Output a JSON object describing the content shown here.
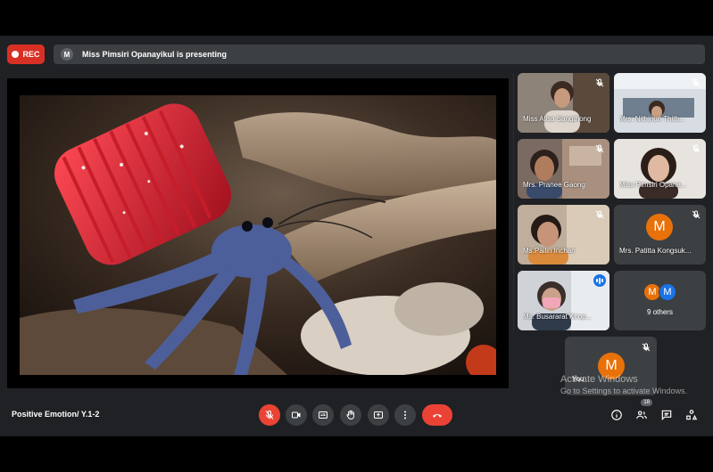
{
  "topbar": {
    "rec_label": "REC",
    "presenter_initial": "M",
    "presenting_text": "Miss Pimsiri Opanayikul is presenting"
  },
  "participants": [
    {
      "name": "Miss Alisa Sangthong"
    },
    {
      "name": "Mrs. Nithinun Thith..."
    },
    {
      "name": "Mrs. Pranee Gaong"
    },
    {
      "name": "Miss Pimsiri Opana..."
    },
    {
      "name": "Ms.Pailin Inchan"
    },
    {
      "name": "Mrs. Patitta Kongsuk...",
      "initial": "M"
    },
    {
      "name": "Ms. Busararat Kirop..."
    }
  ],
  "others": {
    "initials": [
      "M",
      "M"
    ],
    "label": "9 others"
  },
  "self": {
    "name": "You",
    "initial": "M"
  },
  "bottom": {
    "meeting_title": "Positive Emotion/ Y.1-2",
    "participant_count": "18"
  },
  "watermark": {
    "line1": "Activate Windows",
    "line2": "Go to Settings to activate Windows."
  },
  "colors": {
    "background": "#202124",
    "tile": "#3c4043",
    "end_call": "#ea4335",
    "rec": "#d93025",
    "avatar_orange": "#e8710a",
    "avatar_blue": "#1a73e8",
    "active_outline": "#8ab4f8"
  },
  "icons": [
    "mic-off-icon",
    "camera-icon",
    "captions-icon",
    "raise-hand-icon",
    "present-icon",
    "more-icon",
    "end-call-icon",
    "info-icon",
    "people-icon",
    "chat-icon",
    "activities-icon"
  ]
}
